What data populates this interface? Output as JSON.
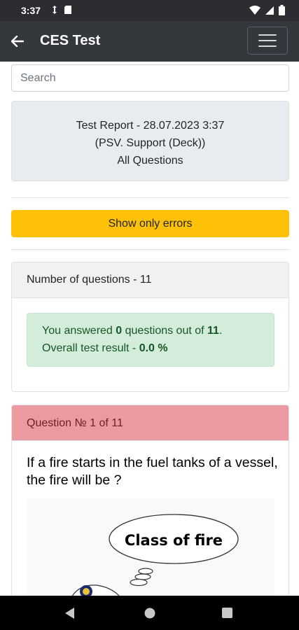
{
  "status_bar": {
    "time": "3:37"
  },
  "app_bar": {
    "title": "CES Test"
  },
  "search": {
    "placeholder": "Search"
  },
  "report": {
    "line1": "Test Report - 28.07.2023 3:37",
    "line2": "(PSV. Support (Deck))",
    "line3": "All Questions"
  },
  "errors_button": {
    "label": "Show only errors"
  },
  "summary": {
    "header": "Number of questions - 11",
    "answered_prefix": "You answered ",
    "answered_count": "0",
    "answered_middle": " questions out of ",
    "total": "11",
    "answered_suffix": ".",
    "result_prefix": "Overall test result - ",
    "result_value": "0.0 %"
  },
  "question": {
    "header": "Question № 1 of 11",
    "text": "If a fire starts in the fuel tanks of a vessel, the fire will be ?",
    "image_caption": "Class of fire"
  },
  "colors": {
    "app_bar": "#34383c",
    "warning": "#ffc107",
    "success_bg": "#d4edda",
    "danger_header": "#ea9aa0"
  }
}
